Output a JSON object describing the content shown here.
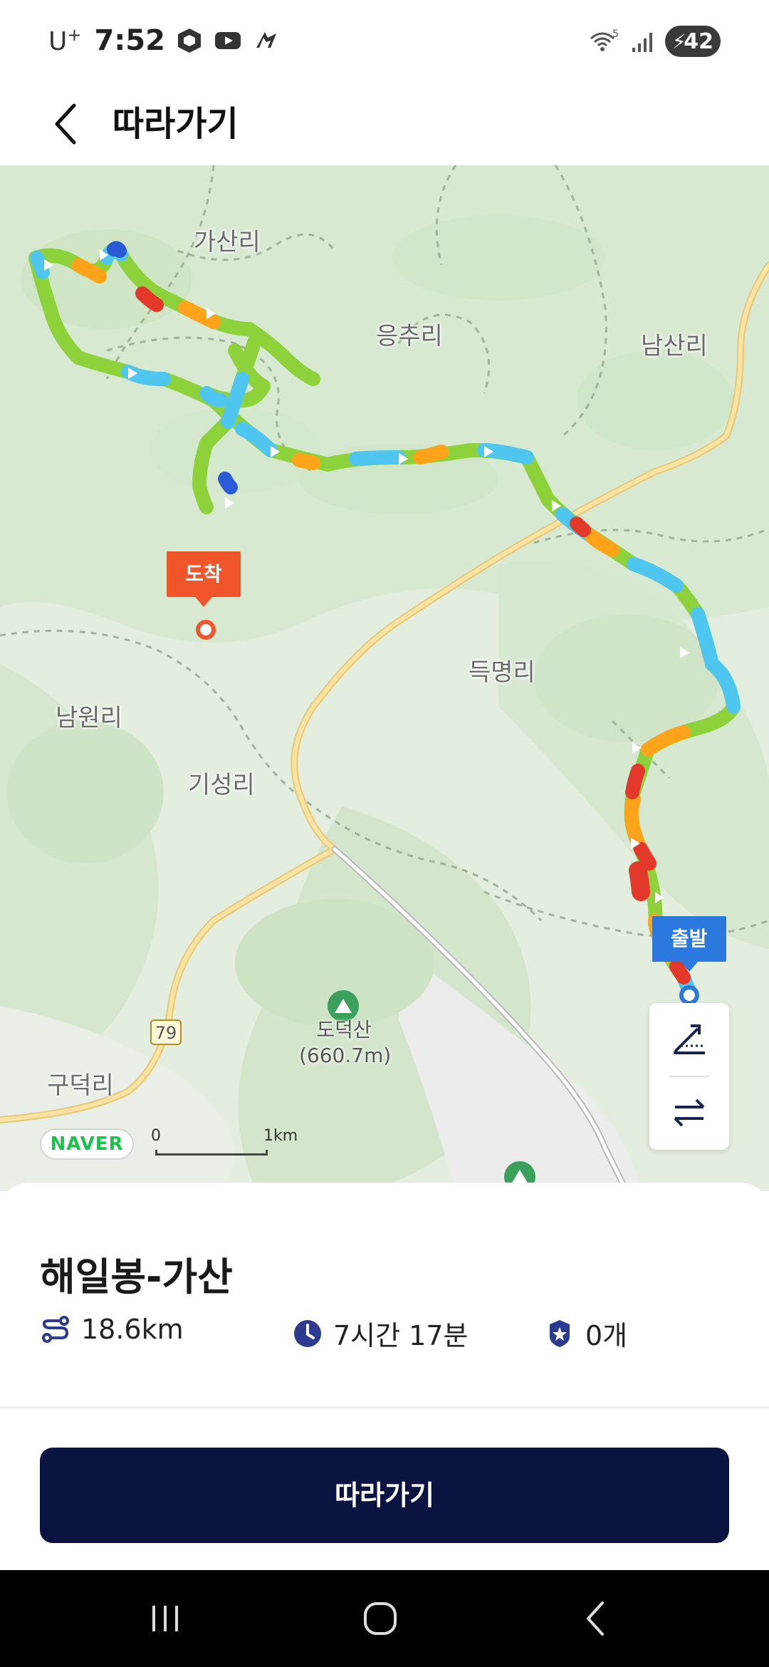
{
  "status_bar": {
    "carrier": "U",
    "carrier_sup": "+",
    "time": "7:52",
    "battery_level": "42",
    "icons": [
      "cube-icon",
      "youtube-icon",
      "app-icon",
      "wifi-icon",
      "signal-icon",
      "battery-icon"
    ],
    "wifi_badge": "5"
  },
  "app_bar": {
    "title": "따라가기",
    "back_icon": "chevron-left-icon"
  },
  "map": {
    "places": {
      "gasan_ri": "가산리",
      "eungchu_ri": "응추리",
      "namsan_ri": "남산리",
      "deungmyeong_ri": "득명리",
      "namwon_ri": "남원리",
      "giseong_ri": "기성리",
      "gudeok_ri": "구덕리"
    },
    "peak_name": "도덕산",
    "peak_height": "(660.7m)",
    "road_number": "79",
    "markers": {
      "arrive": "도착",
      "depart": "출발"
    },
    "logo": "NAVER",
    "scale_start": "0",
    "scale_end": "1km",
    "colors": {
      "route_green": "#8dd23a",
      "route_blue": "#4fc6f0",
      "route_orange": "#ffa31a",
      "route_red": "#e2392a",
      "road_yellow": "#f6dc8e"
    }
  },
  "tools": {
    "elevation_icon": "elevation-slope-icon",
    "swap_icon": "swap-arrows-icon"
  },
  "sheet": {
    "course_title": "해일봉-가산",
    "distance": "18.6km",
    "duration": "7시간 17분",
    "badge_count": "0개",
    "follow_button": "따라가기"
  },
  "nav_bar": {
    "icons": [
      "recent-apps-icon",
      "home-icon",
      "back-icon"
    ]
  }
}
